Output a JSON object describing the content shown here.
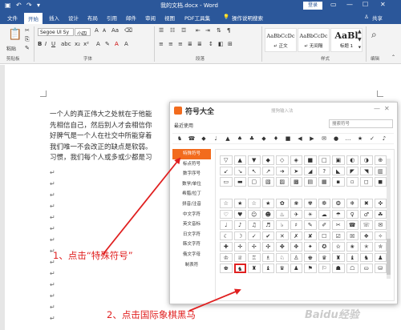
{
  "window": {
    "title": "我的文档.docx - Word",
    "login_label": "登录"
  },
  "ribbon": {
    "tabs": [
      {
        "label": "文件"
      },
      {
        "label": "开始"
      },
      {
        "label": "插入"
      },
      {
        "label": "设计"
      },
      {
        "label": "布局"
      },
      {
        "label": "引用"
      },
      {
        "label": "邮件"
      },
      {
        "label": "审阅"
      },
      {
        "label": "视图"
      },
      {
        "label": "PDF工具集"
      },
      {
        "label": "操作说明搜索"
      }
    ],
    "share_label": "共享",
    "font_name": "Segoe UI Sy",
    "font_size": "小四",
    "groups": {
      "clipboard": "剪贴板",
      "font": "字体",
      "paragraph": "段落",
      "styles": "样式",
      "editing": "编辑"
    },
    "paste_label": "粘贴",
    "styles": [
      {
        "sample": "AaBbCcDc",
        "name": "↵ 正文"
      },
      {
        "sample": "AaBbCcDc",
        "name": "↵ 无间隔"
      },
      {
        "sample": "AaBl",
        "name": "标题 1"
      }
    ]
  },
  "document": {
    "lines": [
      "一个人的真正伟大之处就在于他能",
      "先相信自己，然后别人才会相信你",
      "好脾气是一个人在社交中所能穿着",
      "我们唯一不会改正的缺点是软弱。",
      "习惯，我们每个人或多或少都是习"
    ],
    "para_mark": "↵"
  },
  "dialog": {
    "title": "符号大全",
    "subtitle": "搜狗输入法",
    "recent_label": "最近使用",
    "search_placeholder": "搜索符号",
    "minimize": "—",
    "close": "✕",
    "recent_symbols": [
      "♞",
      "☎",
      "◆",
      "♩",
      "▲",
      "♠",
      "♣",
      "◆",
      "♦",
      "■",
      "◀",
      "▶",
      "✉",
      "●",
      "…",
      "★",
      "✓",
      "♪"
    ],
    "categories": [
      {
        "label": "特殊符号",
        "active": true
      },
      {
        "label": "标点符号"
      },
      {
        "label": "数字序号"
      },
      {
        "label": "数学/单位"
      },
      {
        "label": "希腊/拉丁"
      },
      {
        "label": "拼音/注音"
      },
      {
        "label": "中文字符"
      },
      {
        "label": "英文音标"
      },
      {
        "label": "日文字符"
      },
      {
        "label": "韩文字符"
      },
      {
        "label": "俄文字母"
      },
      {
        "label": "制表符"
      }
    ],
    "grid_rows": [
      [
        "▽",
        "▲",
        "▼",
        "◆",
        "◇",
        "◈",
        "■",
        "□",
        "▣",
        "◐",
        "◑",
        "⊕"
      ],
      [
        "↙",
        "↘",
        "↖",
        "↗",
        "➔",
        "➤",
        "◢",
        "?",
        "◣",
        "◤",
        "◥",
        "▥"
      ],
      [
        "▭",
        "▬",
        "▢",
        "▧",
        "▨",
        "▩",
        "▤",
        "▦",
        "▪",
        "▫",
        "◻",
        "◼"
      ],
      [
        "",
        "",
        "",
        "",
        "",
        "",
        "",
        "",
        "",
        "",
        "",
        ""
      ],
      [
        "☆",
        "★",
        "☆",
        "★",
        "✿",
        "❀",
        "✾",
        "❁",
        "❂",
        "❄",
        "✖",
        "✜"
      ],
      [
        "♡",
        "♥",
        "☺",
        "☻",
        "♨",
        "✈",
        "☀",
        "☁",
        "☂",
        "♀",
        "♂",
        "☘"
      ],
      [
        "♩",
        "♪",
        "♫",
        "♬",
        "♭",
        "♯",
        "✎",
        "✐",
        "✂",
        "☎",
        "☏",
        "✉"
      ],
      [
        "☾",
        "☽",
        "✓",
        "✔",
        "✕",
        "✗",
        "✘",
        "☐",
        "☑",
        "☒",
        "❖",
        "✧"
      ],
      [
        "✚",
        "✛",
        "✢",
        "✣",
        "✤",
        "✥",
        "✦",
        "✪",
        "✫",
        "✬",
        "✭",
        "✮"
      ],
      [
        "♔",
        "♕",
        "♖",
        "♗",
        "♘",
        "♙",
        "♚",
        "♛",
        "♜",
        "♝",
        "♞",
        "♟"
      ],
      [
        "♚",
        "♞",
        "♜",
        "♝",
        "♛",
        "♟",
        "⚑",
        "⚐",
        "☗",
        "☖",
        "⛀",
        "⛁"
      ]
    ]
  },
  "annotations": {
    "step1": "1、点击“特殊符号”",
    "step2": "2、点击国际象棋黑马",
    "color": "#e02020"
  },
  "watermark": "Baidu经验",
  "colors": {
    "word_blue": "#2b579a",
    "sogou_orange": "#f26b1d"
  }
}
